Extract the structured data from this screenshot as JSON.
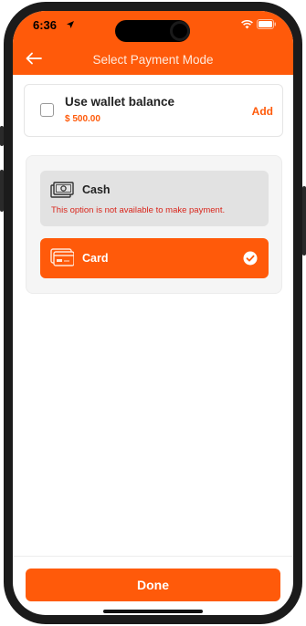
{
  "status_bar": {
    "time": "6:36"
  },
  "header": {
    "title": "Select Payment Mode",
    "back_icon": "back-arrow-icon"
  },
  "wallet": {
    "label": "Use wallet balance",
    "amount": "$ 500.00",
    "add_label": "Add",
    "checked": false
  },
  "payment_options": {
    "cash": {
      "label": "Cash",
      "note": "This option is not available to make payment.",
      "icon": "cash-icon"
    },
    "card": {
      "label": "Card",
      "icon": "card-icon",
      "selected": true
    }
  },
  "footer": {
    "done_label": "Done"
  },
  "colors": {
    "accent": "#ff5a0a",
    "error": "#d9261c",
    "disabled_bg": "#e2e2e2"
  }
}
